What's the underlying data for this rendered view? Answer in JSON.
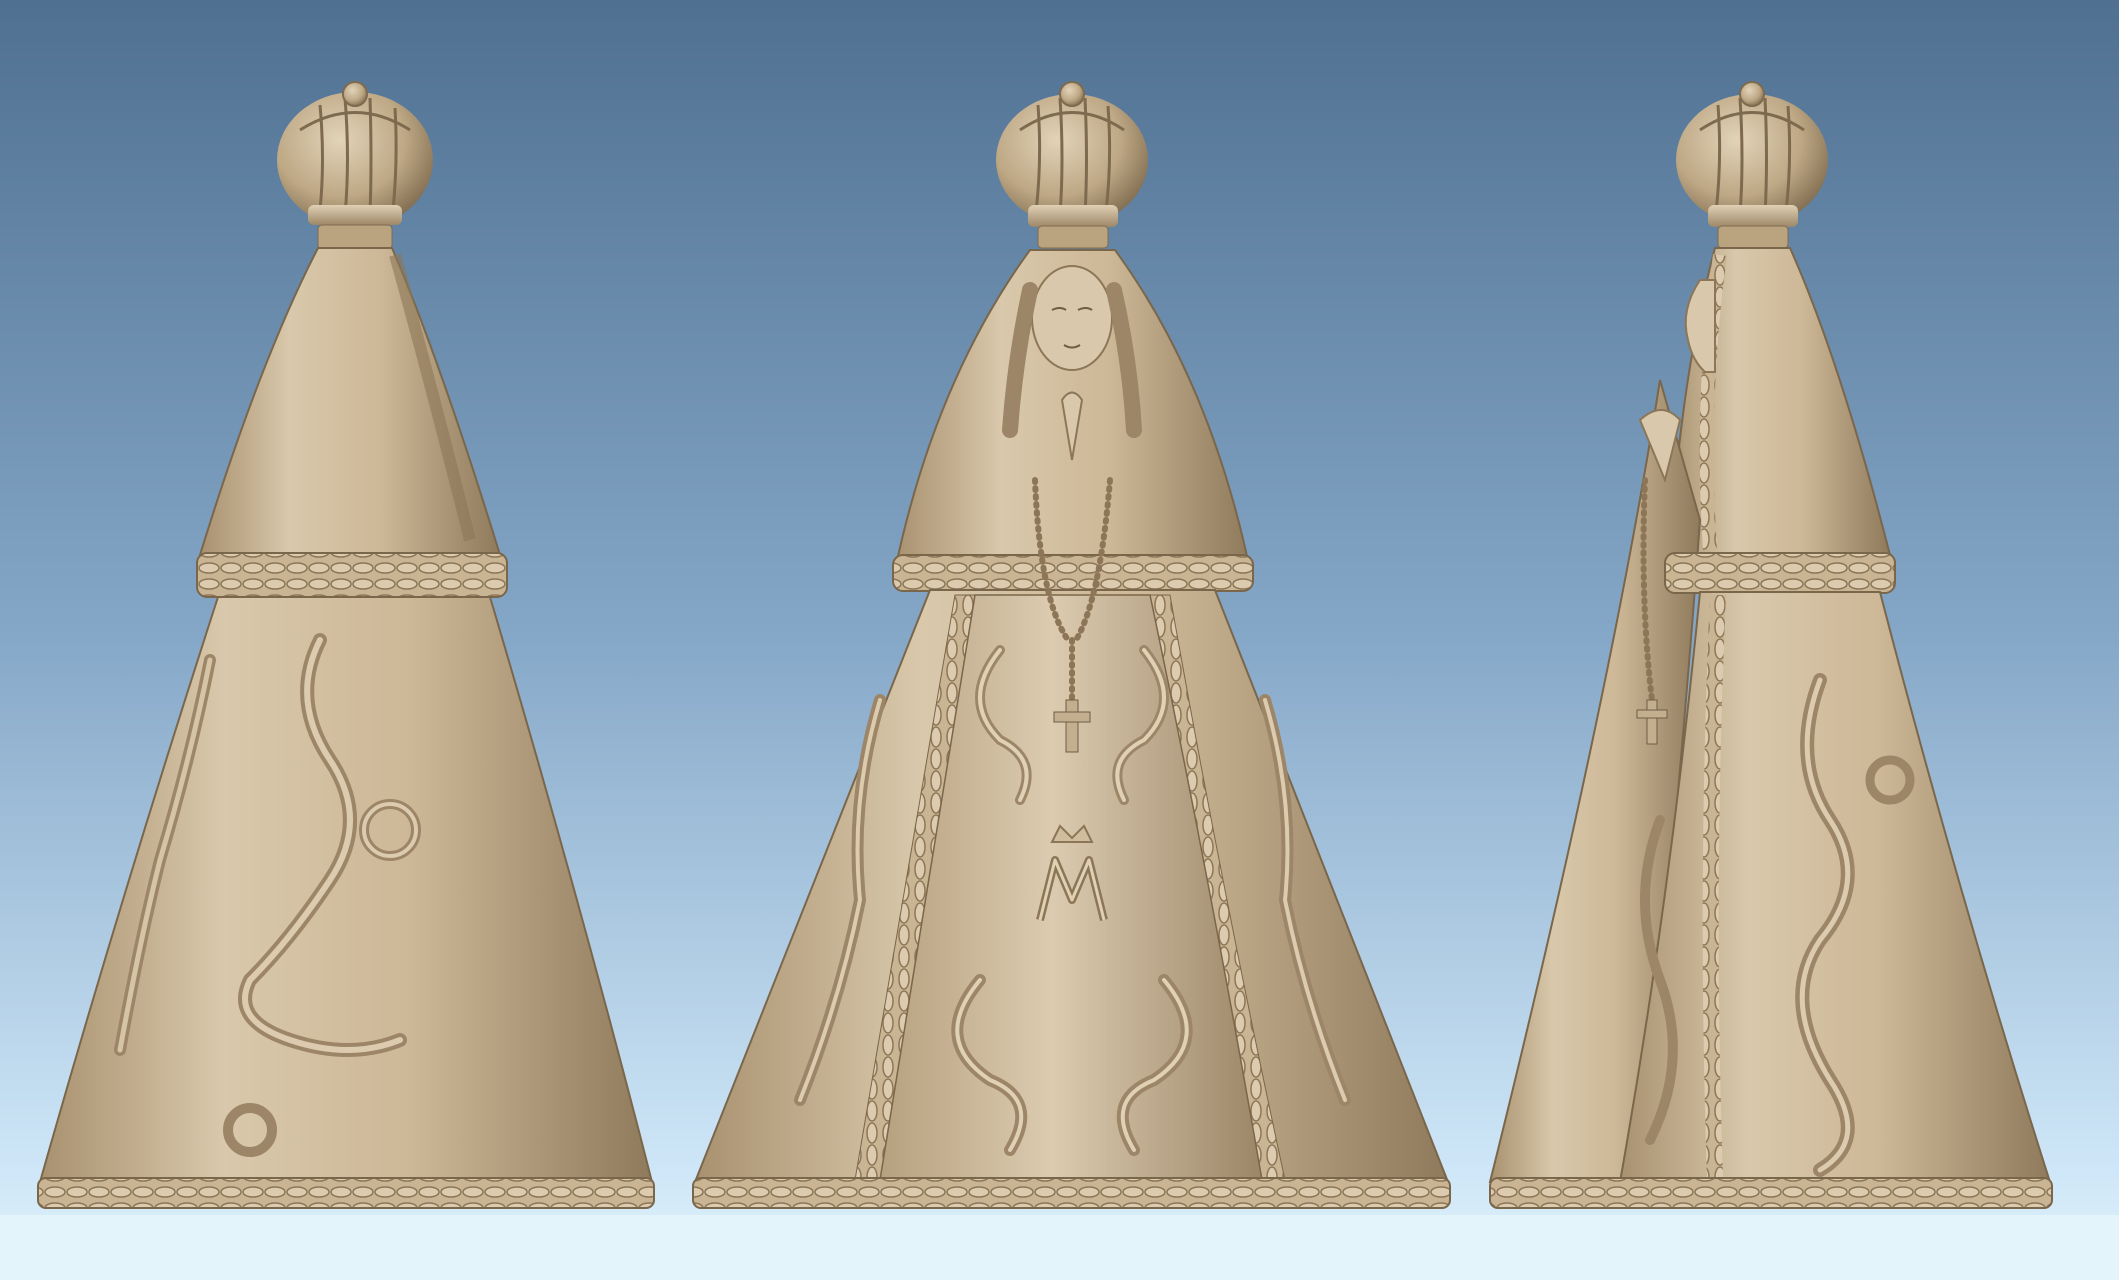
{
  "scene": {
    "description_colors": {
      "sky_top": "#4f7091",
      "sky_bottom": "#d6ecfa",
      "floor": "#e4f4fb",
      "statue_light": "#d7c6aa",
      "statue_mid": "#c3ae8e",
      "statue_dark": "#8e7a5e",
      "statue_shadow": "#6f5e46"
    },
    "views": [
      {
        "name": "back-view"
      },
      {
        "name": "front-view"
      },
      {
        "name": "side-view"
      }
    ]
  }
}
